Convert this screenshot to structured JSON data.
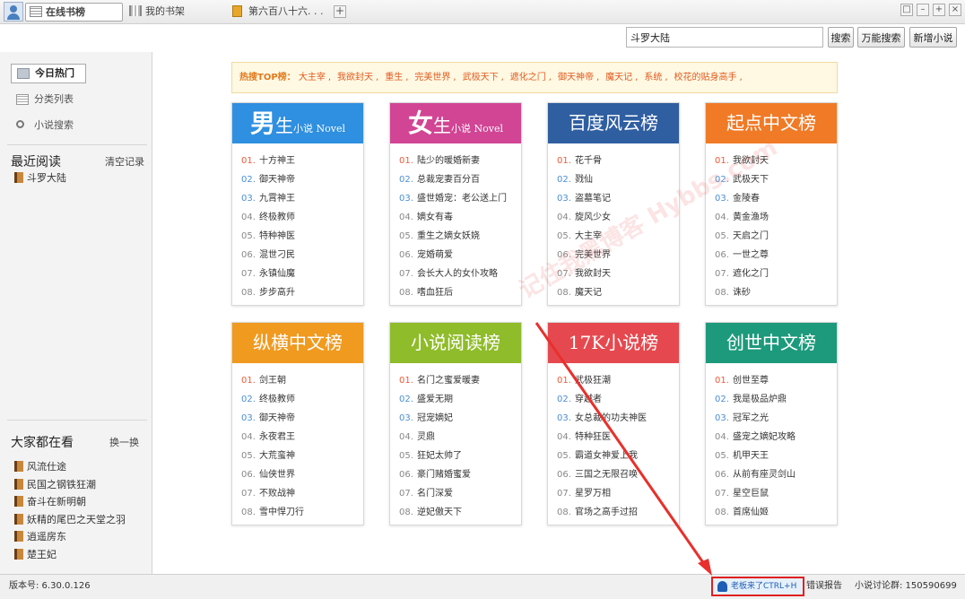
{
  "tabs": [
    {
      "label": "在线书榜",
      "active": true
    },
    {
      "label": "我的书架",
      "active": false
    },
    {
      "label": "第六百八十六. . .",
      "active": false
    }
  ],
  "window": {
    "add_tab": "+",
    "btn1": "□",
    "btn2": "–",
    "btn3": "+",
    "btn4": "×"
  },
  "search": {
    "value": "斗罗大陆",
    "search_btn": "搜索",
    "universal_btn": "万能搜索",
    "add_btn": "新增小说"
  },
  "sidebar": {
    "nav": [
      "今日热门",
      "分类列表",
      "小说搜索"
    ],
    "recent_title": "最近阅读",
    "clear_label": "清空记录",
    "recent_books": [
      "斗罗大陆"
    ],
    "popular_title": "大家都在看",
    "refresh_label": "换一换",
    "popular_books": [
      "风流仕途",
      "民国之钢铁狂潮",
      "奋斗在新明朝",
      "妖精的尾巴之天堂之羽",
      "逍遥房东",
      "楚王妃"
    ]
  },
  "hot": {
    "label": "热搜TOP榜：",
    "keywords": [
      "大主宰",
      "我欲封天",
      "重生",
      "完美世界",
      "武极天下",
      "遮化之门",
      "御天神帝",
      "魔天记",
      "系统",
      "校花的贴身高手"
    ]
  },
  "rankings": [
    {
      "key": "male",
      "title_big": "男",
      "title_rest": "生",
      "title_small": "小说 Novel",
      "items": [
        "十方神王",
        "御天神帝",
        "九霄神王",
        "终极教师",
        "特种神医",
        "混世刁民",
        "永镇仙魔",
        "步步高升"
      ]
    },
    {
      "key": "female",
      "title_big": "女",
      "title_rest": "生",
      "title_small": "小说 Novel",
      "items": [
        "陆少的暖婚新妻",
        "总裁宠妻百分百",
        "盛世婚宠：老公送上门",
        "嫡女有毒",
        "重生之嫡女妖娆",
        "宠婚萌爱",
        "会长大人的女仆攻略",
        "嗜血狂后"
      ]
    },
    {
      "key": "baidu",
      "title": "百度风云榜",
      "items": [
        "花千骨",
        "戮仙",
        "盗墓笔记",
        "旋风少女",
        "大主宰",
        "完美世界",
        "我欲封天",
        "魔天记"
      ]
    },
    {
      "key": "qidian",
      "title": "起点中文榜",
      "items": [
        "我欲封天",
        "武极天下",
        "金陵春",
        "黄金渔场",
        "天启之门",
        "一世之尊",
        "遮化之门",
        "诛砂"
      ]
    },
    {
      "key": "zongheng",
      "title": "纵横中文榜",
      "items": [
        "剑王朝",
        "终极教师",
        "御天神帝",
        "永夜君王",
        "大荒蛮神",
        "仙侠世界",
        "不败战神",
        "雪中悍刀行"
      ]
    },
    {
      "key": "xiaoshuo",
      "title": "小说阅读榜",
      "items": [
        "名门之蜜爱暖妻",
        "盛爱无期",
        "冠宠嫡妃",
        "灵鼎",
        "狂妃太帅了",
        "豪门赌婚蜜爱",
        "名门深爱",
        "逆妃傲天下"
      ]
    },
    {
      "key": "17k",
      "title": "17K小说榜",
      "items": [
        "武极狂潮",
        "穿越者",
        "女总裁的功夫神医",
        "特种狂医",
        "霸道女神爱上我",
        "三国之无限召唤",
        "星罗万相",
        "官场之高手过招"
      ]
    },
    {
      "key": "chuangshi",
      "title": "创世中文榜",
      "items": [
        "创世至尊",
        "我是极品炉鼎",
        "冠军之光",
        "盛宠之嫡妃攻略",
        "机甲天王",
        "从前有座灵剑山",
        "星空巨鼠",
        "首席仙姬"
      ]
    }
  ],
  "rank_numbers": [
    "01.",
    "02.",
    "03.",
    "04.",
    "05.",
    "06.",
    "07.",
    "08."
  ],
  "watermark": "记住我黑博客 Hybbs.com",
  "status": {
    "version": "版本号: 6.30.0.126",
    "boss_key": "老板来了CTRL+H",
    "report": "错误报告",
    "forum": "小说讨论群: 150590699"
  },
  "colors": {
    "accent_red": "#e02020",
    "hot_orange": "#e05a1f"
  }
}
